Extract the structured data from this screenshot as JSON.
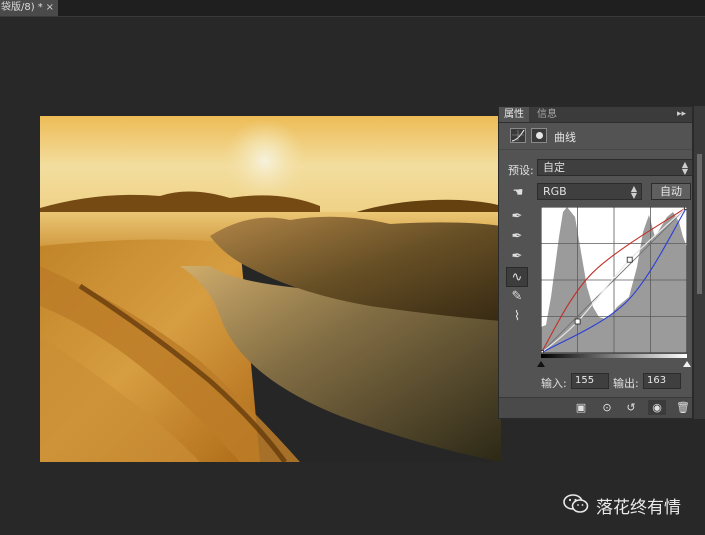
{
  "document_tab": {
    "title": "袋版/8) *",
    "close": "×"
  },
  "panel": {
    "tabs": [
      "属性",
      "信息"
    ],
    "menu": "▸▸",
    "title": "曲线",
    "preset_label": "预设:",
    "preset_value": "自定",
    "channel_value": "RGB",
    "auto_label": "自动",
    "input_label": "输入:",
    "input_value": "155",
    "output_label": "输出:",
    "output_value": "163"
  },
  "curves": {
    "rgb_points": [
      [
        0,
        0
      ],
      [
        64,
        55
      ],
      [
        155,
        163
      ],
      [
        255,
        255
      ]
    ],
    "red_points": [
      [
        0,
        0
      ],
      [
        90,
        140
      ],
      [
        255,
        255
      ]
    ],
    "blue_points": [
      [
        0,
        0
      ],
      [
        150,
        90
      ],
      [
        255,
        255
      ]
    ],
    "colors": {
      "rgb": "#e8e8e8",
      "red": "#c0302a",
      "blue": "#2b3fd6"
    }
  },
  "watermark": {
    "text": "落花终有情"
  },
  "colors": {
    "background": "#282828",
    "panel": "#535353"
  }
}
